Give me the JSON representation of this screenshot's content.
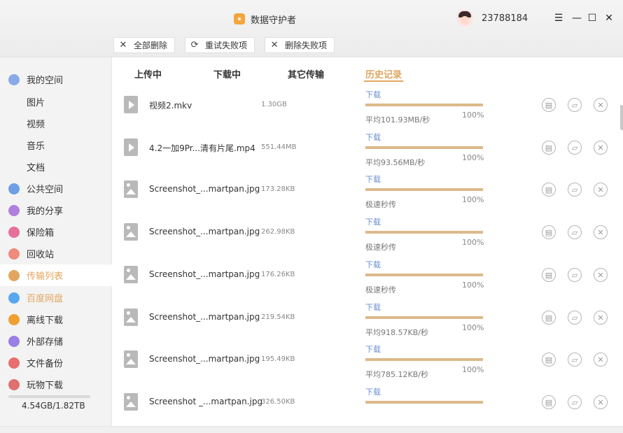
{
  "app": {
    "title": "数据守护者",
    "username": "23788184"
  },
  "toolbar": {
    "delete_all": "全部删除",
    "retry_failed": "重试失败项",
    "delete_failed": "删除失败项"
  },
  "sidebar": {
    "items": [
      {
        "label": "我的空间",
        "icon": "my-space-icon",
        "color": "#8aa9e8"
      },
      {
        "label": "图片"
      },
      {
        "label": "视频"
      },
      {
        "label": "音乐"
      },
      {
        "label": "文档"
      },
      {
        "label": "公共空间",
        "icon": "public-space-icon",
        "color": "#6d9fe6"
      },
      {
        "label": "我的分享",
        "icon": "share-icon",
        "color": "#b07fe0"
      },
      {
        "label": "保险箱",
        "icon": "safe-icon",
        "color": "#e86f9b"
      },
      {
        "label": "回收站",
        "icon": "trash-icon",
        "color": "#f08a7a"
      },
      {
        "label": "传输列表",
        "icon": "transfer-icon",
        "color": "#e2a660"
      },
      {
        "label": "百度网盘",
        "icon": "baidu-icon",
        "color": "#5aa7f0"
      },
      {
        "label": "离线下载",
        "icon": "offline-download-icon",
        "color": "#f0a030"
      },
      {
        "label": "外部存储",
        "icon": "external-storage-icon",
        "color": "#9a7fe6"
      },
      {
        "label": "文件备份",
        "icon": "backup-icon",
        "color": "#e86f6f"
      },
      {
        "label": "玩物下载",
        "icon": "wanwu-icon",
        "color": "#e07070"
      }
    ],
    "storage": "4.54GB/1.82TB",
    "storage_used_fraction": 0.0025
  },
  "tabs": [
    "上传中",
    "下载中",
    "其它传输",
    "历史记录"
  ],
  "active_tab": "历史记录",
  "transfers": [
    {
      "name": "视频2.mkv",
      "size": "1.30GB",
      "status": "下载",
      "speed": "平均101.93MB/秒",
      "percent": "100%",
      "type": "video"
    },
    {
      "name": "4.2一加9Pr...清有片尾.mp4",
      "size": "551.44MB",
      "status": "下载",
      "speed": "平均93.56MB/秒",
      "percent": "100%",
      "type": "video"
    },
    {
      "name": "Screenshot_...martpan.jpg",
      "size": "173.28KB",
      "status": "下载",
      "speed": "极速秒传",
      "percent": "100%",
      "type": "image"
    },
    {
      "name": "Screenshot_...martpan.jpg",
      "size": "262.98KB",
      "status": "下载",
      "speed": "极速秒传",
      "percent": "100%",
      "type": "image"
    },
    {
      "name": "Screenshot_...martpan.jpg",
      "size": "176.26KB",
      "status": "下载",
      "speed": "极速秒传",
      "percent": "100%",
      "type": "image"
    },
    {
      "name": "Screenshot_...martpan.jpg",
      "size": "219.54KB",
      "status": "下载",
      "speed": "平均918.57KB/秒",
      "percent": "100%",
      "type": "image"
    },
    {
      "name": "Screenshot_...martpan.jpg",
      "size": "195.49KB",
      "status": "下载",
      "speed": "平均785.12KB/秒",
      "percent": "100%",
      "type": "image"
    },
    {
      "name": "Screenshot _...martpan.jpg",
      "size": "326.50KB",
      "status": "下载",
      "speed": "",
      "percent": "",
      "type": "image"
    }
  ],
  "accent_color": "#e2a660"
}
